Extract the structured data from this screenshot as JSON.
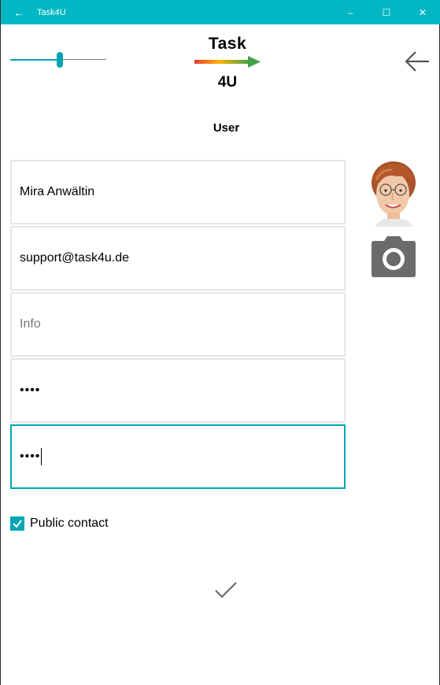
{
  "window": {
    "title": "Task4U",
    "back_icon": "arrow-left-icon",
    "controls": [
      "minimize-icon",
      "maximize-icon",
      "close-icon"
    ],
    "accent_color": "#00b7c3"
  },
  "header": {
    "logo_top": "Task",
    "logo_bottom": "4U",
    "slider_level": 0.5,
    "back_icon": "arrow-left-icon"
  },
  "page": {
    "title": "User"
  },
  "form": {
    "name_value": "Mira Anwältin",
    "email_value": "support@task4u.de",
    "info_placeholder": "Info",
    "password_value": "••••",
    "password_confirm_value": "••••"
  },
  "public_contact": {
    "checked": true,
    "label": "Public contact"
  },
  "actions": {
    "confirm_icon": "checkmark-icon",
    "photo_icon": "camera-icon",
    "avatar_icon": "avatar-photo"
  }
}
